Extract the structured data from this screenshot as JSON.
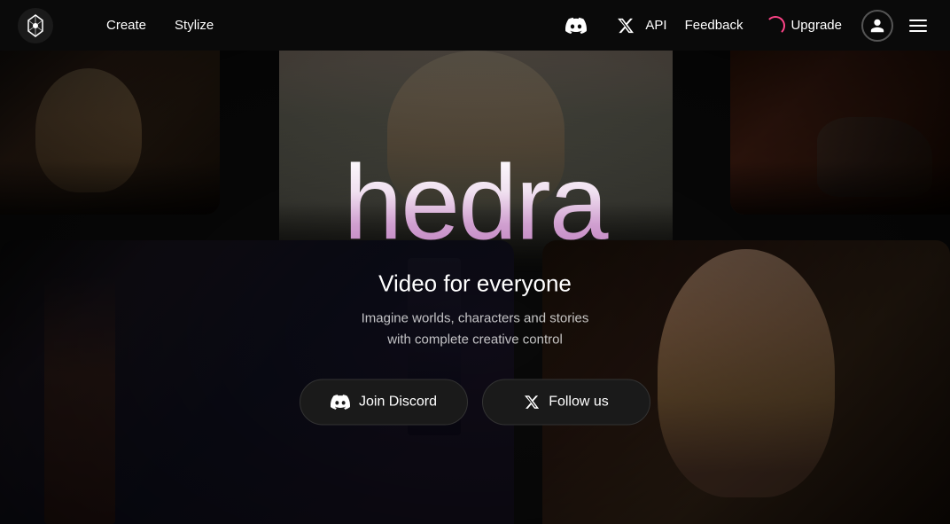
{
  "navbar": {
    "logo_alt": "Hedra logo",
    "nav_links": [
      {
        "id": "create",
        "label": "Create"
      },
      {
        "id": "stylize",
        "label": "Stylize"
      }
    ],
    "api_label": "API",
    "feedback_label": "Feedback",
    "upgrade_label": "Upgrade",
    "discord_icon": "discord-icon",
    "x_icon": "x-icon",
    "account_icon": "account-icon",
    "menu_icon": "menu-icon"
  },
  "hero": {
    "brand_name": "hedra",
    "subtitle": "Video for everyone",
    "description_line1": "Imagine worlds, characters and stories",
    "description_line2": "with complete creative control",
    "btn_discord": "Join Discord",
    "btn_twitter": "Follow us"
  }
}
